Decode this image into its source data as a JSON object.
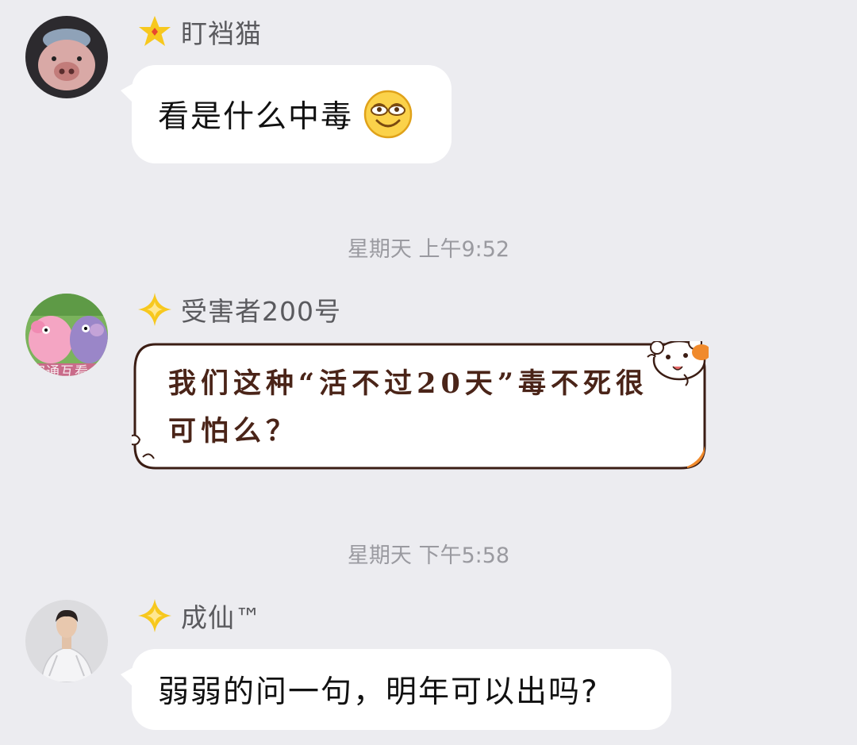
{
  "messages": [
    {
      "sender": "盯裆猫",
      "text": "看是什么中毒",
      "emoji": "smug-smile-emoji",
      "avatar": "pig-avatar",
      "badge": "star-badge"
    },
    {
      "timestamp": "星期天 上午9:52"
    },
    {
      "sender": "受害者200号",
      "text": "我们这种“活不过20天”毒不死很可怕么？",
      "avatar": "peppa-pig-avatar",
      "avatar_overlay_text": "容通互看",
      "badge": "sparkle-badge",
      "bubble_style": "hamster-bubble"
    },
    {
      "timestamp": "星期天 下午5:58"
    },
    {
      "sender": "成仙™",
      "text": "弱弱的问一句，明年可以出吗?",
      "avatar": "person-avatar",
      "badge": "sparkle-badge"
    }
  ],
  "colors": {
    "background": "#ececf0",
    "bubble": "#ffffff",
    "badge_yellow": "#f7c81e",
    "fancy_text": "#4a2418",
    "fancy_border": "#3b1d14",
    "hamster_orange": "#f08a2c"
  }
}
